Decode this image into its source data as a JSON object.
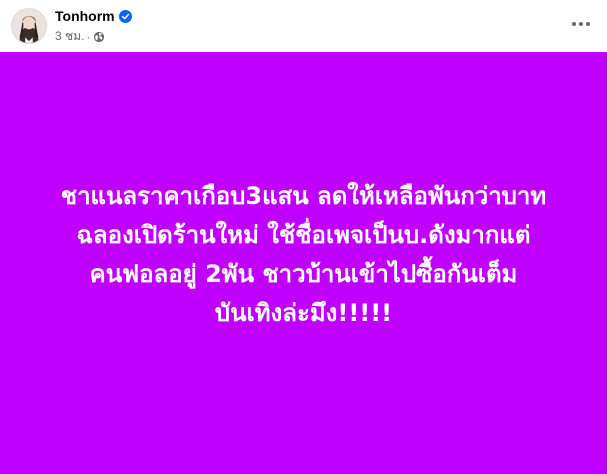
{
  "post": {
    "author": "Tonhorm",
    "time": "3 ชม.",
    "separator": "·",
    "background_color": "#c000ff",
    "text_color": "#ffffff",
    "lines": [
      "ชาแนลราคาเกือบ3แสน ลดให้เหลือพันกว่าบาท",
      "ฉลองเปิดร้านใหม่ ใช้ชื่อเพจเป็นบ.ดังมากแต่",
      "คนฟอลอยู่ 2พัน ชาวบ้านเข้าไปซื้อกันเต็ม",
      "บันเทิงล่ะมึง!!!!!"
    ]
  },
  "icons": {
    "verified": "verified-badge-icon",
    "audience": "globe-icon",
    "more": "more-options-icon"
  },
  "colors": {
    "verified_blue": "#0866ff",
    "meta_gray": "#65676b",
    "name_black": "#050505"
  }
}
